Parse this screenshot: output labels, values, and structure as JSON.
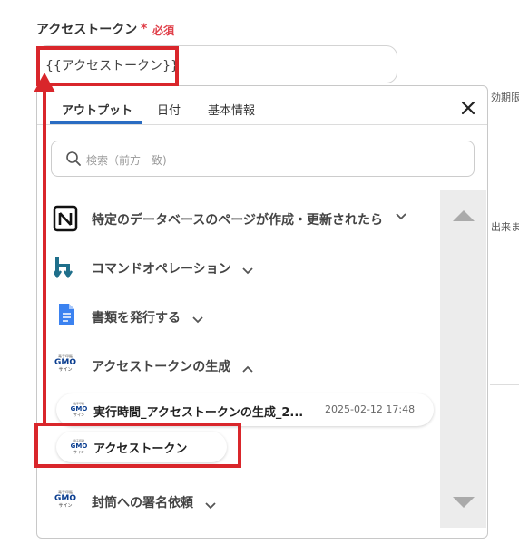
{
  "field": {
    "label": "アクセストークン",
    "required_mark": "*",
    "required_text": "必須",
    "value": "{{アクセストークン}}"
  },
  "side_labels": [
    "効期限",
    "出来ま"
  ],
  "tabs": [
    {
      "label": "アウトプット",
      "active": true
    },
    {
      "label": "日付",
      "active": false
    },
    {
      "label": "基本情報",
      "active": false
    }
  ],
  "search": {
    "placeholder": "検索（前方一致)"
  },
  "items": [
    {
      "label": "特定のデータベースのページが作成・更新されたら",
      "icon": "notion-icon",
      "expanded": false
    },
    {
      "label": "コマンドオペレーション",
      "icon": "command-operation-icon",
      "expanded": false
    },
    {
      "label": "書類を発行する",
      "icon": "google-docs-icon",
      "expanded": false
    },
    {
      "label": "アクセストークンの生成",
      "icon": "gmo-sign-icon",
      "expanded": true
    },
    {
      "label": "封筒への署名依頼",
      "icon": "gmo-sign-icon",
      "expanded": false
    }
  ],
  "outputs": [
    {
      "label": "実行時間_アクセストークンの生成_2...",
      "timestamp": "2025-02-12 17:48"
    },
    {
      "label": "アクセストークン"
    }
  ],
  "logo_text": {
    "gmo_small": "電子印鑑",
    "gmo_main": "GMO",
    "gmo_sub": "サイン"
  },
  "colors": {
    "accent": "#2a6cc2",
    "highlight": "#d9262b",
    "required": "#e0404a"
  }
}
